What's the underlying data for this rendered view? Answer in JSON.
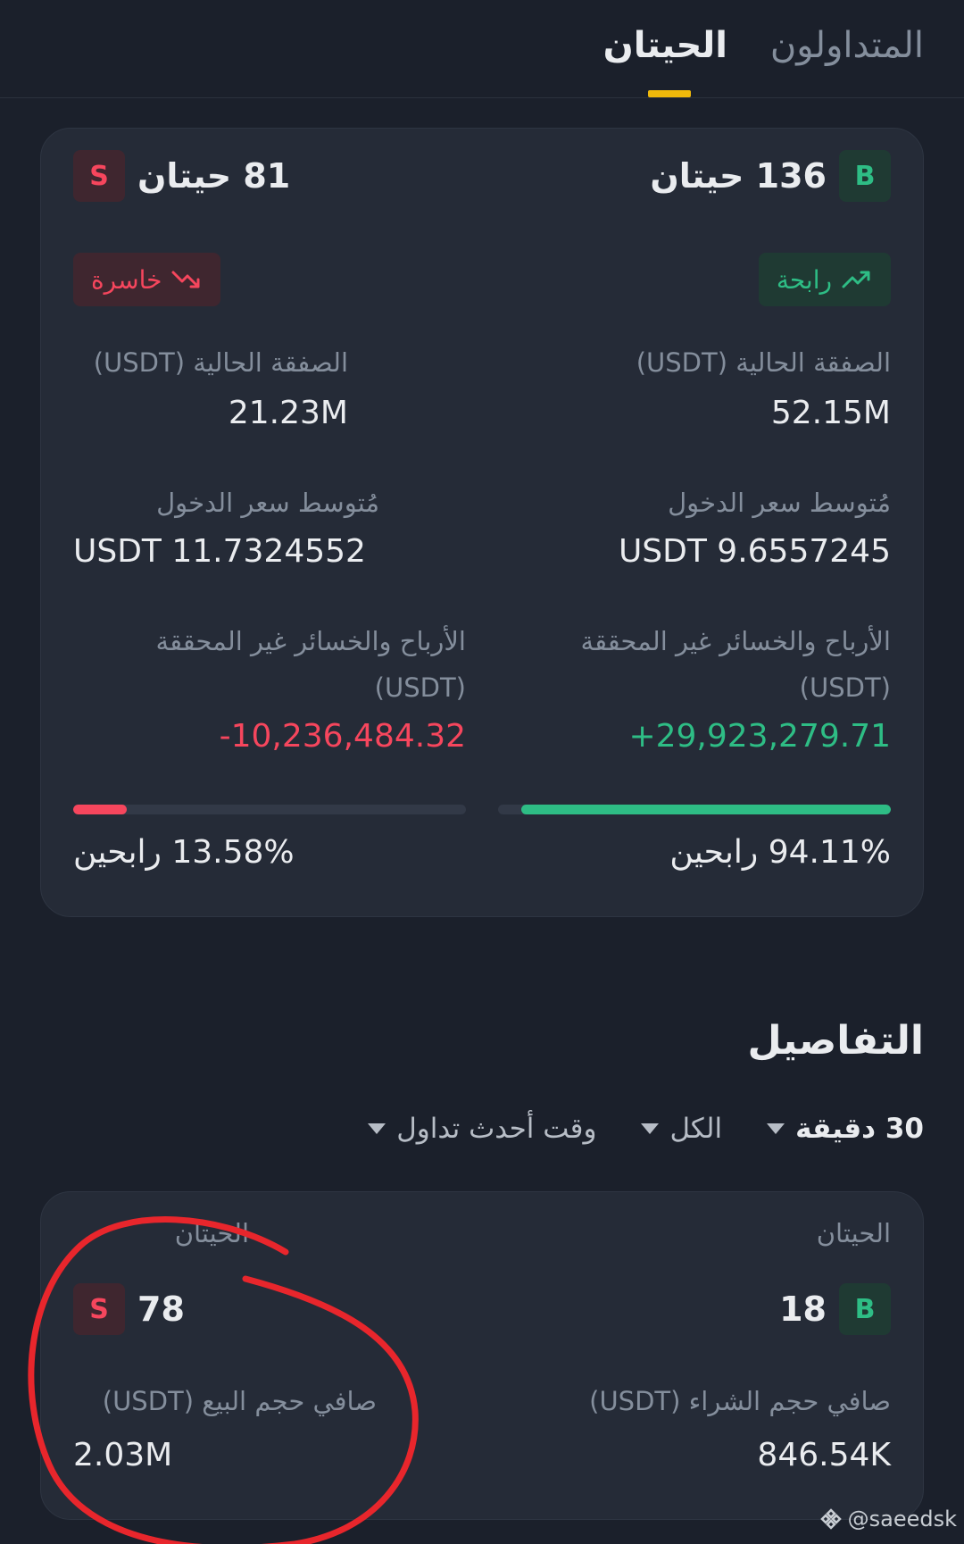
{
  "tabs": {
    "traders": "المتداولون",
    "whales": "الحيتان"
  },
  "summary": {
    "buy": {
      "badge": "B",
      "whales": "136 حيتان",
      "status": "رابحة",
      "position_label": "الصفقة الحالية (USDT)",
      "position_value": "52.15M",
      "avg_entry_label": "مُتوسط سعر الدخول",
      "avg_entry_value": "USDT 9.6557245",
      "pnl_label_1": "الأرباح والخسائر غير المحققة",
      "pnl_label_2": "(USDT)",
      "pnl_value": "29,923,279.71+",
      "win_rate_text": "94.11% رابحين",
      "win_rate": 0.9411
    },
    "sell": {
      "badge": "S",
      "whales": "81 حيتان",
      "status": "خاسرة",
      "position_label": "الصفقة الحالية (USDT)",
      "position_value": "21.23M",
      "avg_entry_label": "مُتوسط سعر الدخول",
      "avg_entry_value": "USDT 11.7324552",
      "pnl_label_1": "الأرباح والخسائر غير المحققة",
      "pnl_label_2": "(USDT)",
      "pnl_value": "10,236,484.32-",
      "win_rate_text": "13.58% رابحين",
      "win_rate": 0.1358
    }
  },
  "details": {
    "title": "التفاصيل",
    "filters": {
      "interval": "30 دقيقة",
      "scope": "الكل",
      "sort": "وقت أحدث تداول"
    },
    "buy": {
      "label": "الحيتان",
      "badge": "B",
      "count": "18",
      "volume_label": "صافي حجم الشراء (USDT)",
      "volume_value": "846.54K"
    },
    "sell": {
      "label": "الحيتان",
      "badge": "S",
      "count": "78",
      "volume_label": "صافي حجم البيع (USDT)",
      "volume_value": "2.03M"
    }
  },
  "watermark": "@saeedsk",
  "colors": {
    "buy": "#2ebd85",
    "sell": "#f6465d",
    "accent": "#f0b90b",
    "annotation": "#e8262c"
  }
}
